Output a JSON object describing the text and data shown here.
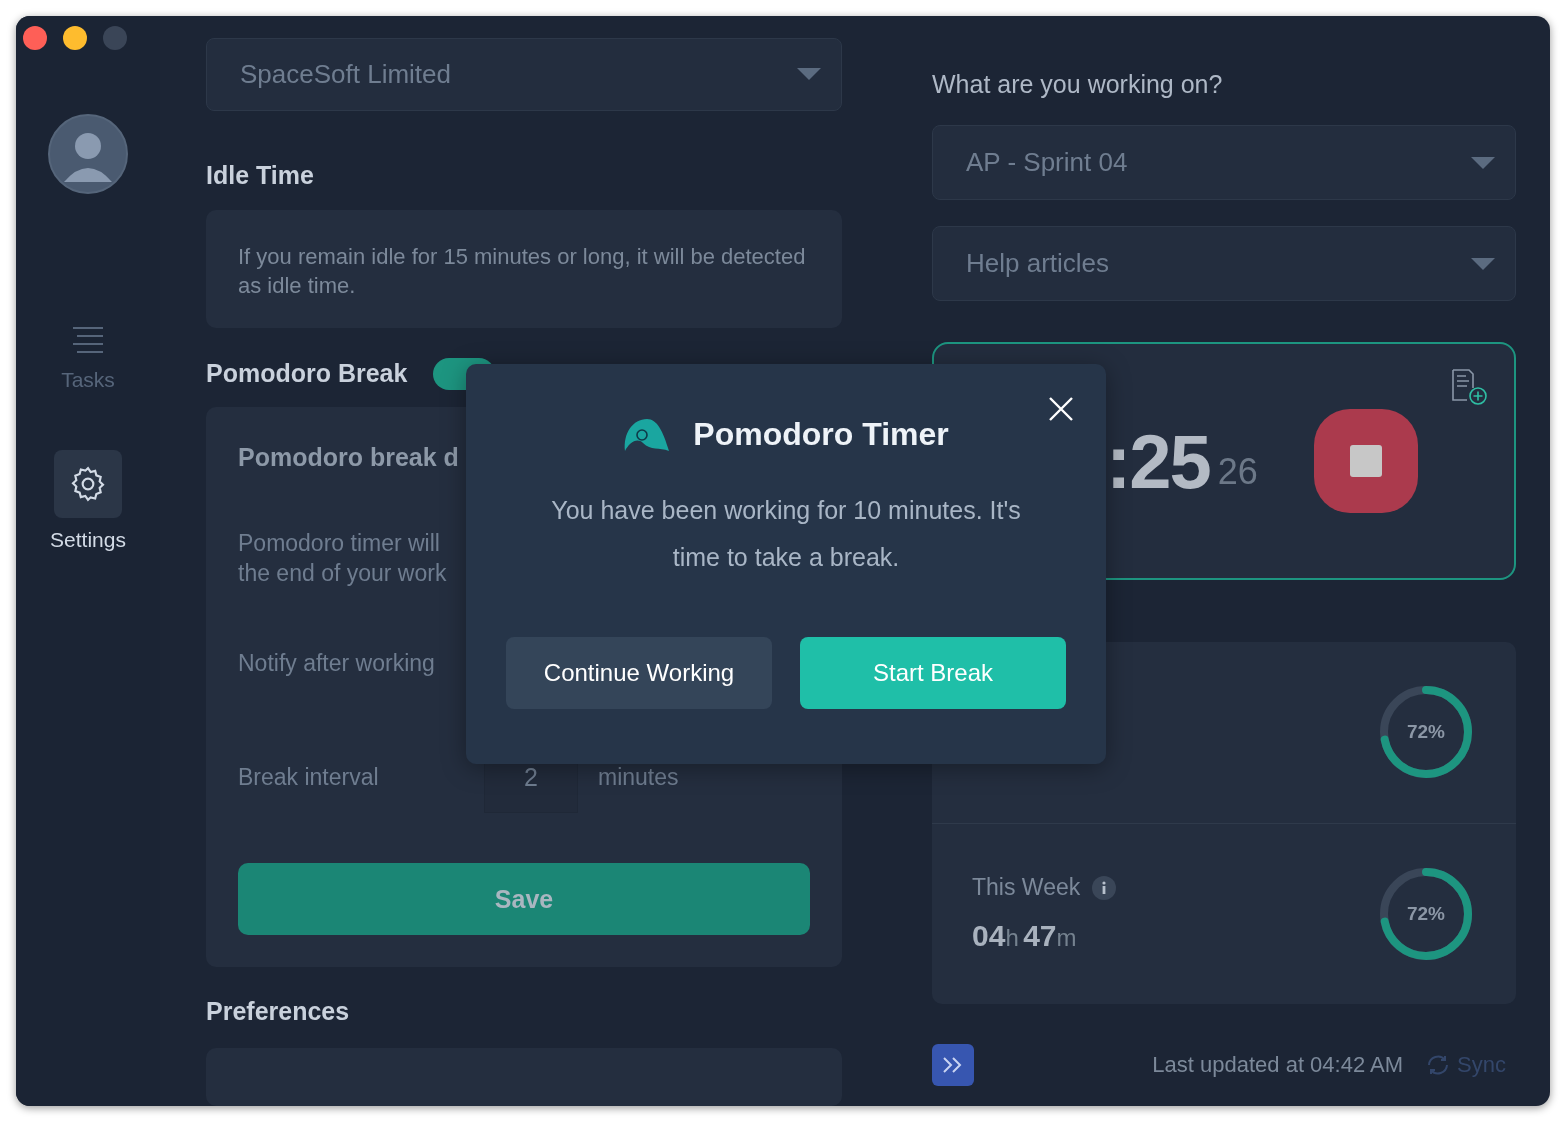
{
  "window": {
    "controls": [
      {
        "color": "#fe5f57"
      },
      {
        "color": "#febc2e"
      },
      {
        "color": "#3a4557"
      }
    ]
  },
  "sidebar": {
    "items": [
      {
        "kind": "tasks",
        "label": "Tasks",
        "selected": false
      },
      {
        "kind": "settings",
        "label": "Settings",
        "selected": true
      }
    ]
  },
  "settings": {
    "company_dropdown": {
      "value": "SpaceSoft Limited"
    },
    "idle_time": {
      "heading": "Idle Time",
      "description": "If you remain idle for 15 minutes or long, it will be detected as idle time."
    },
    "pomodoro": {
      "heading": "Pomodoro Break",
      "toggle": {
        "on": true
      },
      "subheading": "Pomodoro break d",
      "description_lines": [
        "Pomodoro timer will",
        "the end of your work"
      ],
      "notify_label": "Notify after working",
      "interval_label": "Break interval",
      "interval_value": "2",
      "interval_unit": "minutes",
      "save": "Save"
    },
    "preferences": {
      "heading": "Preferences"
    }
  },
  "tracker": {
    "prompt": "What are you working on?",
    "project_dropdown": {
      "value": "AP - Sprint 04"
    },
    "help_dropdown": {
      "value": "Help articles"
    },
    "timer": {
      "time": ":25",
      "seconds": "26"
    },
    "stats": [
      {
        "percent": "72%",
        "level": 0.72
      },
      {
        "title": "This Week",
        "hours": "04",
        "hours_unit": "h",
        "minutes": "47",
        "minutes_unit": "m",
        "percent": "72%",
        "level": 0.72
      }
    ]
  },
  "footer": {
    "last_updated": "Last updated at 04:42 AM",
    "sync": {
      "label": "Sync",
      "disabled": true
    }
  },
  "modal": {
    "title": "Pomodoro Timer",
    "message": "You have been working for 10 minutes. It's time to take a break.",
    "buttons": [
      {
        "label": "Continue Working",
        "kind": "secondary"
      },
      {
        "label": "Start Break",
        "kind": "primary"
      }
    ]
  }
}
